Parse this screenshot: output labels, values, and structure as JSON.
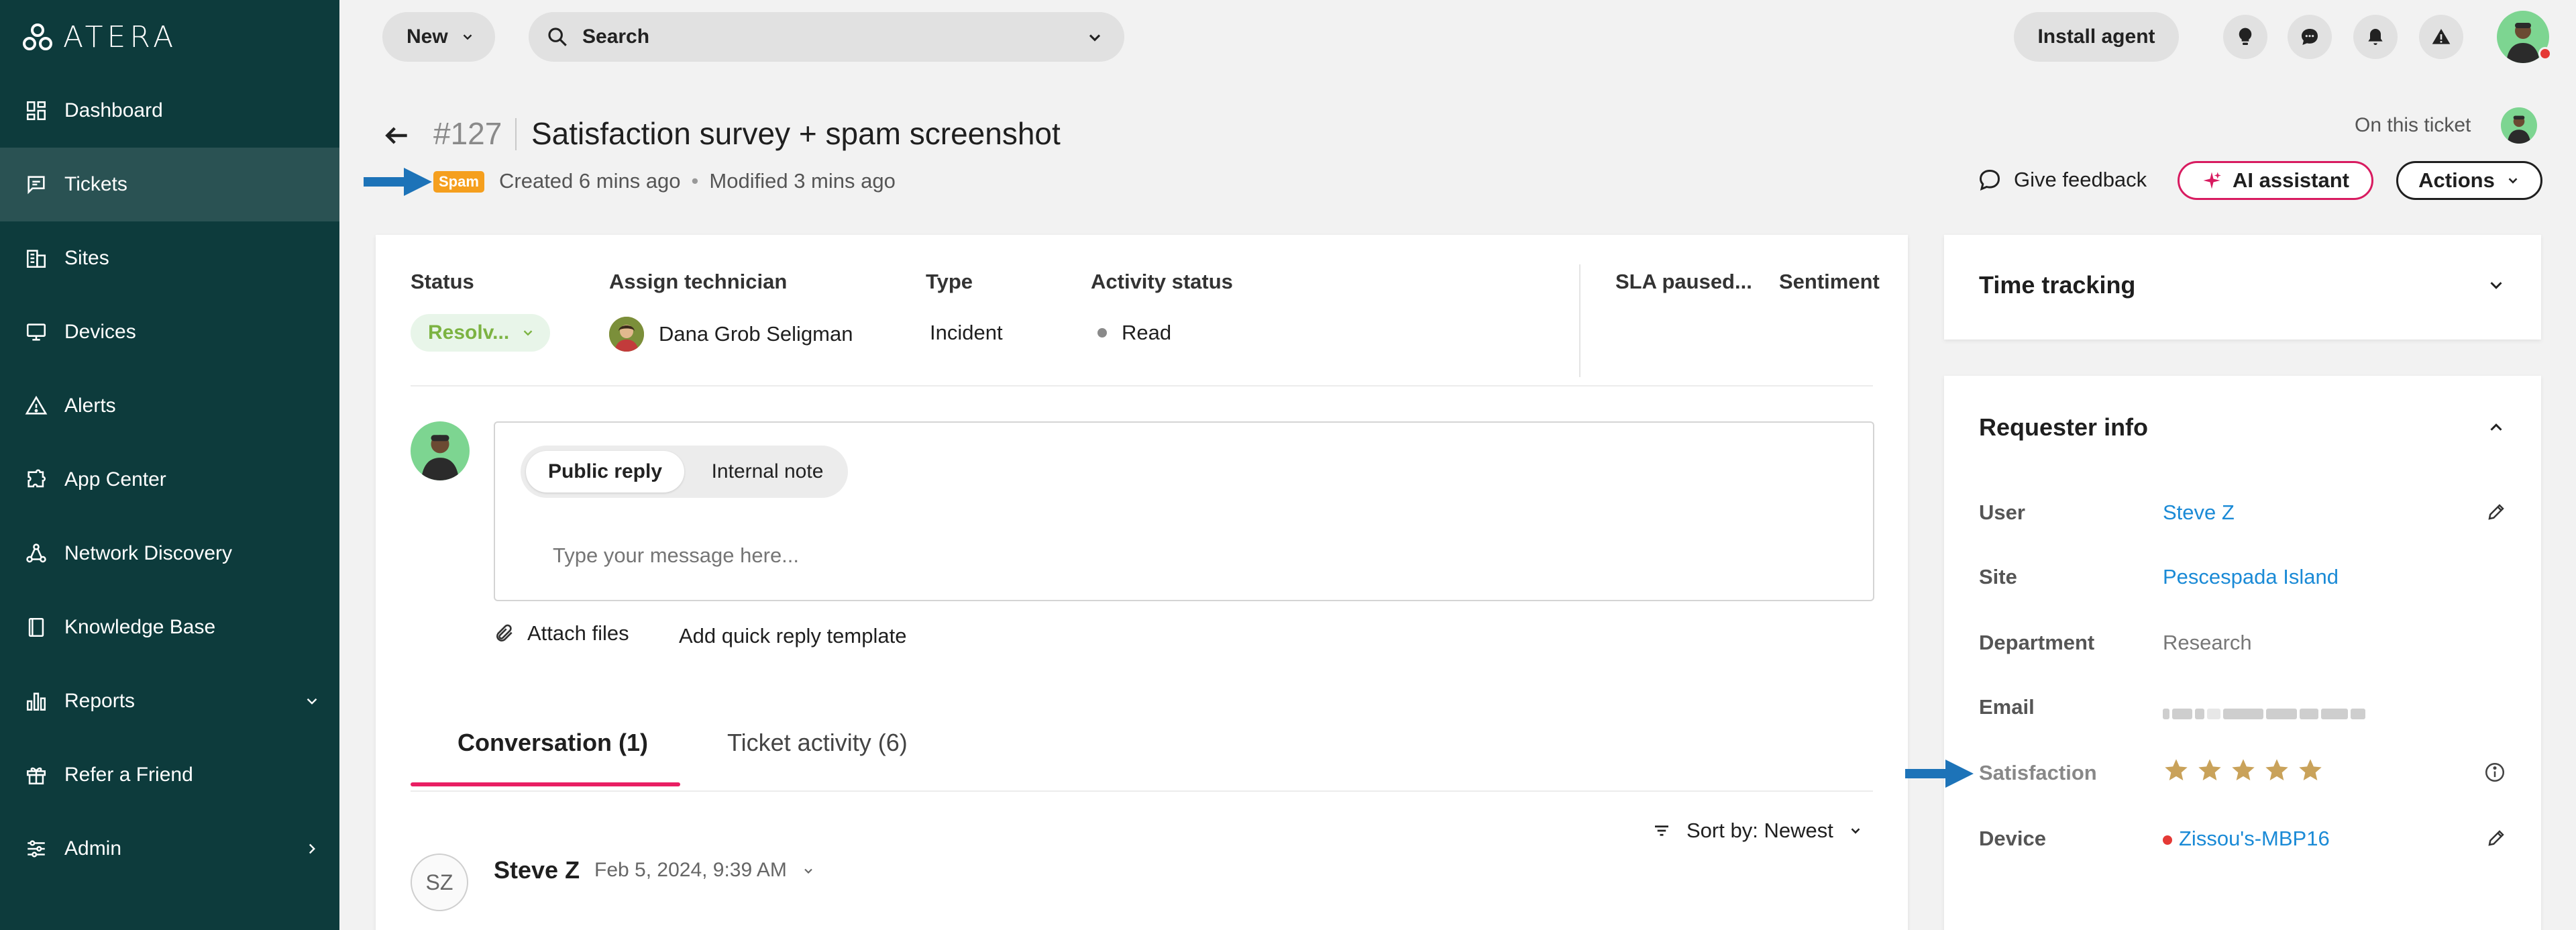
{
  "app": {
    "logo_text": "ATERA"
  },
  "sidebar": {
    "items": [
      {
        "label": "Dashboard",
        "icon": "dashboard-icon"
      },
      {
        "label": "Tickets",
        "icon": "tickets-icon",
        "active": true
      },
      {
        "label": "Sites",
        "icon": "sites-icon"
      },
      {
        "label": "Devices",
        "icon": "devices-icon"
      },
      {
        "label": "Alerts",
        "icon": "alerts-icon"
      },
      {
        "label": "App Center",
        "icon": "app-center-icon"
      },
      {
        "label": "Network Discovery",
        "icon": "network-discovery-icon"
      },
      {
        "label": "Knowledge Base",
        "icon": "knowledge-base-icon"
      },
      {
        "label": "Reports",
        "icon": "reports-icon",
        "expand": "down"
      },
      {
        "label": "Refer a Friend",
        "icon": "gift-icon"
      },
      {
        "label": "Admin",
        "icon": "admin-icon",
        "expand": "right"
      }
    ]
  },
  "topbar": {
    "new_label": "New",
    "search_label": "Search",
    "install_label": "Install agent"
  },
  "ticket": {
    "number": "#127",
    "title": "Satisfaction survey + spam screenshot",
    "spam_badge": "Spam",
    "created": "Created 6 mins ago",
    "separator": "•",
    "modified": "Modified 3 mins ago",
    "on_this_ticket": "On this ticket",
    "give_feedback": "Give feedback",
    "ai_assistant": "AI assistant",
    "actions": "Actions"
  },
  "fields": {
    "status_label": "Status",
    "status_value": "Resolv...",
    "technician_label": "Assign technician",
    "technician_value": "Dana Grob Seligman",
    "type_label": "Type",
    "type_value": "Incident",
    "activity_label": "Activity status",
    "activity_value": "Read",
    "sla_label": "SLA paused...",
    "sentiment_label": "Sentiment"
  },
  "reply": {
    "public_reply": "Public reply",
    "internal_note": "Internal note",
    "placeholder": "Type your message here...",
    "attach_files": "Attach files",
    "quick_reply": "Add quick reply template"
  },
  "tabs": {
    "conversation": "Conversation (1)",
    "activity": "Ticket activity (6)"
  },
  "sort": {
    "prefix": "Sort by:",
    "value": "Newest"
  },
  "conversation": {
    "initials": "SZ",
    "author": "Steve Z",
    "date": "Feb 5, 2024, 9:39 AM"
  },
  "time_tracking": {
    "title": "Time tracking"
  },
  "requester": {
    "title": "Requester info",
    "user_label": "User",
    "user_value": "Steve Z",
    "site_label": "Site",
    "site_value": "Pescespada Island",
    "department_label": "Department",
    "department_value": "Research",
    "email_label": "Email",
    "satisfaction_label": "Satisfaction",
    "satisfaction_rating": 5,
    "satisfaction_max": 5,
    "device_label": "Device",
    "device_value": "Zissou's-MBP16"
  },
  "colors": {
    "sidebar_bg": "#0d3b3c",
    "accent_pink": "#e91e63",
    "link_blue": "#1a8ad6",
    "spam_orange": "#f59f1e",
    "status_green": "#7cb342",
    "star_gold": "#c9a25a",
    "arrow_blue": "#1d73b8"
  }
}
